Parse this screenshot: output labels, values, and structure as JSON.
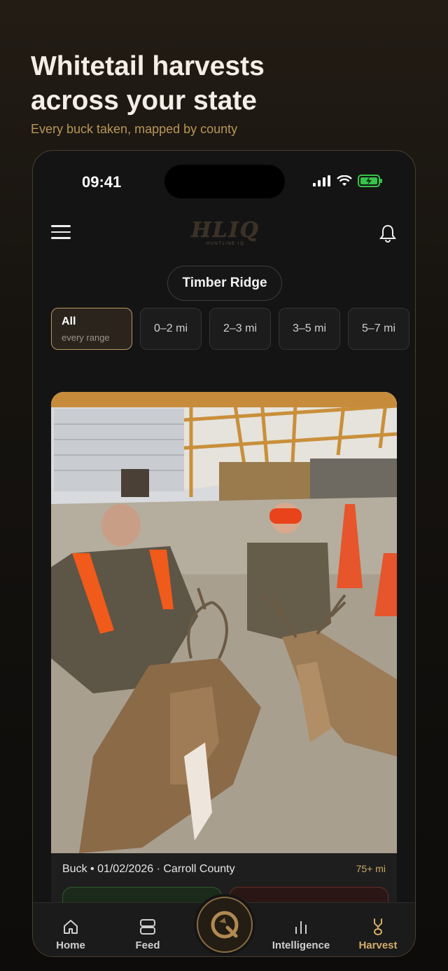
{
  "promo": {
    "title": "Whitetail harvests\nacross your state",
    "subtitle": "Every buck taken, mapped by county"
  },
  "status_bar": {
    "time": "09:41"
  },
  "header": {
    "logo_text": "HLIQ",
    "logo_subtext": "HUNTLINE IQ"
  },
  "location": {
    "label": "Timber Ridge"
  },
  "range_filters": [
    {
      "label": "All",
      "sublabel": "every range",
      "active": true
    },
    {
      "label": "0–2 mi"
    },
    {
      "label": "2–3 mi"
    },
    {
      "label": "3–5 mi"
    },
    {
      "label": "5–7 mi"
    }
  ],
  "harvest_card": {
    "meta": "Buck • 01/02/2026 · Carroll County",
    "distance": "75+ mi"
  },
  "tabbar": {
    "tabs": [
      {
        "label": "Home",
        "icon": "home-icon"
      },
      {
        "label": "Feed",
        "icon": "feed-icon"
      },
      {
        "label": "Intelligence",
        "icon": "chart-bars-icon"
      },
      {
        "label": "Harvest",
        "icon": "antler-icon",
        "active": true
      }
    ]
  },
  "colors": {
    "accent": "#c9a968",
    "background": "#141414"
  }
}
